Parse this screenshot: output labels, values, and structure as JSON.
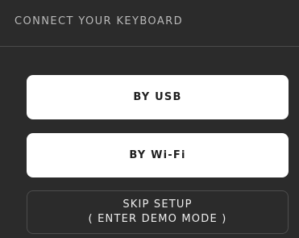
{
  "header": {
    "title": "CONNECT YOUR KEYBOARD"
  },
  "buttons": {
    "usb_label": "BY USB",
    "wifi_label": "BY Wi-Fi",
    "skip_line1": "SKIP SETUP",
    "skip_line2": "( ENTER DEMO MODE )"
  },
  "colors": {
    "background": "#2b2b2b",
    "primary_button": "#ffffff",
    "header_text": "#b9b9b9"
  }
}
